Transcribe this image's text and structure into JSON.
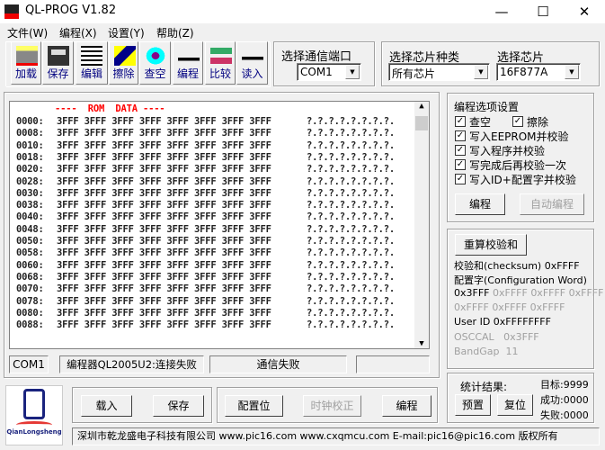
{
  "window": {
    "title": "QL-PROG V1.82",
    "icon_text": "PIC16"
  },
  "menu": [
    "文件(W)",
    "编程(X)",
    "设置(Y)",
    "帮助(Z)"
  ],
  "toolbar": [
    {
      "label": "加载",
      "icon": "open-folder-icon"
    },
    {
      "label": "保存",
      "icon": "floppy-disk-icon"
    },
    {
      "label": "编辑",
      "icon": "edit-icon"
    },
    {
      "label": "擦除",
      "icon": "erase-icon"
    },
    {
      "label": "查空",
      "icon": "blank-check-icon"
    },
    {
      "label": "编程",
      "icon": "program-chip-icon"
    },
    {
      "label": "比较",
      "icon": "compare-icon"
    },
    {
      "label": "读入",
      "icon": "read-icon"
    }
  ],
  "port": {
    "label": "选择通信端口",
    "value": "COM1"
  },
  "chip_type": {
    "label": "选择芯片种类",
    "value": "所有芯片"
  },
  "chip": {
    "label": "选择芯片",
    "value": "16F877A"
  },
  "rom": {
    "header": "----  ROM  DATA ----",
    "rows": [
      {
        "addr": "0000:",
        "hex": "3FFF 3FFF 3FFF 3FFF 3FFF 3FFF 3FFF 3FFF",
        "ascii": "?.?.?.?.?.?.?.?."
      },
      {
        "addr": "0008:",
        "hex": "3FFF 3FFF 3FFF 3FFF 3FFF 3FFF 3FFF 3FFF",
        "ascii": "?.?.?.?.?.?.?.?."
      },
      {
        "addr": "0010:",
        "hex": "3FFF 3FFF 3FFF 3FFF 3FFF 3FFF 3FFF 3FFF",
        "ascii": "?.?.?.?.?.?.?.?."
      },
      {
        "addr": "0018:",
        "hex": "3FFF 3FFF 3FFF 3FFF 3FFF 3FFF 3FFF 3FFF",
        "ascii": "?.?.?.?.?.?.?.?."
      },
      {
        "addr": "0020:",
        "hex": "3FFF 3FFF 3FFF 3FFF 3FFF 3FFF 3FFF 3FFF",
        "ascii": "?.?.?.?.?.?.?.?."
      },
      {
        "addr": "0028:",
        "hex": "3FFF 3FFF 3FFF 3FFF 3FFF 3FFF 3FFF 3FFF",
        "ascii": "?.?.?.?.?.?.?.?."
      },
      {
        "addr": "0030:",
        "hex": "3FFF 3FFF 3FFF 3FFF 3FFF 3FFF 3FFF 3FFF",
        "ascii": "?.?.?.?.?.?.?.?."
      },
      {
        "addr": "0038:",
        "hex": "3FFF 3FFF 3FFF 3FFF 3FFF 3FFF 3FFF 3FFF",
        "ascii": "?.?.?.?.?.?.?.?."
      },
      {
        "addr": "0040:",
        "hex": "3FFF 3FFF 3FFF 3FFF 3FFF 3FFF 3FFF 3FFF",
        "ascii": "?.?.?.?.?.?.?.?."
      },
      {
        "addr": "0048:",
        "hex": "3FFF 3FFF 3FFF 3FFF 3FFF 3FFF 3FFF 3FFF",
        "ascii": "?.?.?.?.?.?.?.?."
      },
      {
        "addr": "0050:",
        "hex": "3FFF 3FFF 3FFF 3FFF 3FFF 3FFF 3FFF 3FFF",
        "ascii": "?.?.?.?.?.?.?.?."
      },
      {
        "addr": "0058:",
        "hex": "3FFF 3FFF 3FFF 3FFF 3FFF 3FFF 3FFF 3FFF",
        "ascii": "?.?.?.?.?.?.?.?."
      },
      {
        "addr": "0060:",
        "hex": "3FFF 3FFF 3FFF 3FFF 3FFF 3FFF 3FFF 3FFF",
        "ascii": "?.?.?.?.?.?.?.?."
      },
      {
        "addr": "0068:",
        "hex": "3FFF 3FFF 3FFF 3FFF 3FFF 3FFF 3FFF 3FFF",
        "ascii": "?.?.?.?.?.?.?.?."
      },
      {
        "addr": "0070:",
        "hex": "3FFF 3FFF 3FFF 3FFF 3FFF 3FFF 3FFF 3FFF",
        "ascii": "?.?.?.?.?.?.?.?."
      },
      {
        "addr": "0078:",
        "hex": "3FFF 3FFF 3FFF 3FFF 3FFF 3FFF 3FFF 3FFF",
        "ascii": "?.?.?.?.?.?.?.?."
      },
      {
        "addr": "0080:",
        "hex": "3FFF 3FFF 3FFF 3FFF 3FFF 3FFF 3FFF 3FFF",
        "ascii": "?.?.?.?.?.?.?.?."
      },
      {
        "addr": "0088:",
        "hex": "3FFF 3FFF 3FFF 3FFF 3FFF 3FFF 3FFF 3FFF",
        "ascii": "?.?.?.?.?.?.?.?."
      }
    ]
  },
  "status": {
    "port": "COM1",
    "programmer": "编程器QL2005U2:连接失败",
    "comm": "通信失败",
    "extra": ""
  },
  "options": {
    "title": "编程选项设置",
    "blank": {
      "label": "查空",
      "checked": true
    },
    "erase": {
      "label": "擦除",
      "checked": true
    },
    "items": [
      {
        "label": "写入EEPROM并校验",
        "checked": true
      },
      {
        "label": "写入程序并校验",
        "checked": true
      },
      {
        "label": "写完成后再校验一次",
        "checked": true
      },
      {
        "label": "写入ID+配置字并校验",
        "checked": true
      }
    ],
    "program_btn": "编程",
    "auto_btn": "自动编程"
  },
  "checksum": {
    "recalc_btn": "重算校验和",
    "checksum_line": "校验和(checksum) 0xFFFF",
    "config_label": "配置字(Configuration Word)",
    "config_first": "0x3FFF",
    "config_rest1": "0xFFFF 0xFFFF 0xFFFF",
    "config_rest2": "0xFFFF 0xFFFF 0xFFFF",
    "userid": "User ID  0xFFFFFFFF",
    "osccal": "OSCCAL   0x3FFF",
    "bandgap": "BandGap  11"
  },
  "bottom": {
    "logo_text": "QianLongsheng",
    "load": "载入",
    "save": "保存",
    "config": "配置位",
    "clock": "时钟校正",
    "program": "编程",
    "stats_title": "统计结果:",
    "target": "目标:9999",
    "success": "成功:0000",
    "fail": "失败:0000",
    "preset": "预置",
    "reset": "复位",
    "footer": "深圳市乾龙盛电子科技有限公司 www.pic16.com www.cxqmcu.com E-mail:pic16@pic16.com 版权所有"
  },
  "colors": {
    "rom_header": "#ff0000",
    "toolbar_label": "#000080",
    "disabled": "#a0a0a0"
  }
}
